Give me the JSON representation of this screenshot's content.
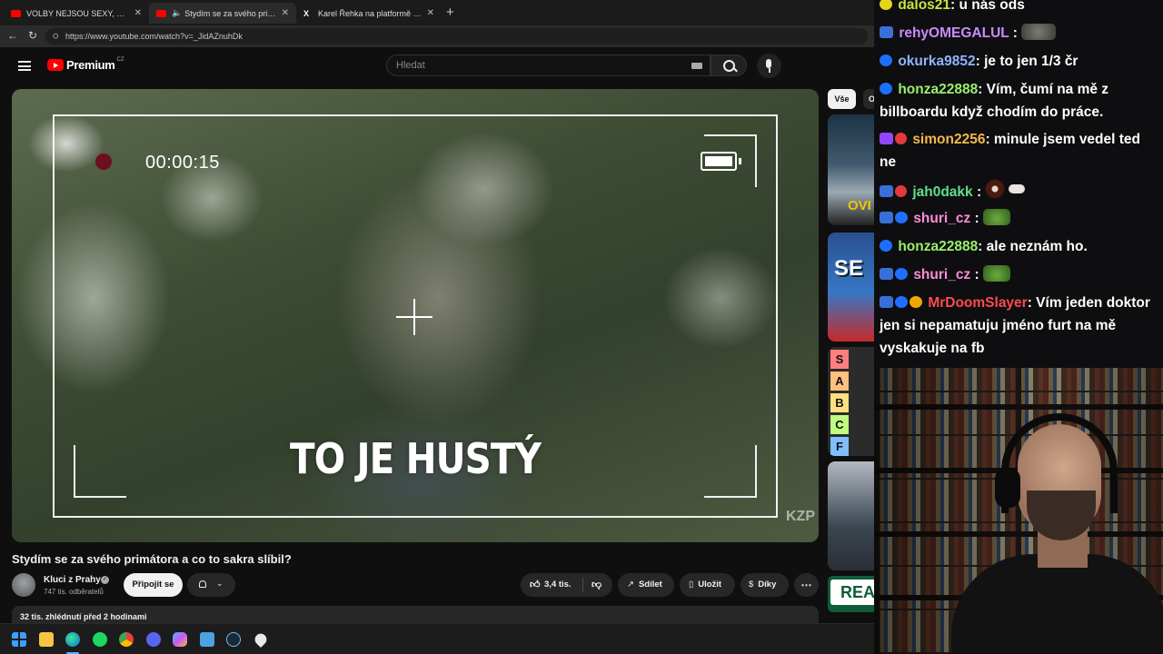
{
  "browser": {
    "tabs": [
      {
        "label": "VOLBY NEJSOU SEXY, Z NICH NEM",
        "icon": "youtube-icon",
        "active": false
      },
      {
        "label": "Stydím se za svého primátora",
        "icon": "youtube-icon",
        "active": true
      },
      {
        "label": "Karel Řehka na platformě X: „Po vi",
        "icon": "x-icon",
        "active": false
      }
    ],
    "url": "https://www.youtube.com/watch?v=_JidAZnuhDk"
  },
  "youtube": {
    "logo_text": "Premium",
    "logo_region": "CZ",
    "search_placeholder": "Hledat",
    "video": {
      "timecode": "00:00:15",
      "subtitle": "TO JE HUSTÝ",
      "watermark": "KZP"
    },
    "title": "Stydím se za svého primátora a co to sakra slíbil?",
    "channel": {
      "name": "Kluci z Prahy",
      "subscribers": "747 tis. odběratelů"
    },
    "join_label": "Připojit se",
    "likes": "3,4 tis.",
    "share_label": "Sdílet",
    "save_label": "Uložit",
    "thanks_label": "Díky",
    "description_meta": "32 tis. zhlédnutí  před 2 hodinami",
    "chips": [
      "Vše",
      "O"
    ],
    "recommendations": {
      "rec1_text": "OVI",
      "rec2_text": "SE",
      "rec3_tiers": [
        {
          "label": "S",
          "color": "#ff7f7f"
        },
        {
          "label": "A",
          "color": "#ffbf7f"
        },
        {
          "label": "B",
          "color": "#ffdf7f"
        },
        {
          "label": "C",
          "color": "#bfff7f"
        },
        {
          "label": "F",
          "color": "#7fbfff"
        }
      ],
      "rec5_text": "REA"
    }
  },
  "chat": {
    "messages": [
      {
        "user": "dalos21",
        "color": "#c8e63a",
        "text": ": u nás ods",
        "badges": [
          "yellow"
        ]
      },
      {
        "user": "rehyOMEGALUL",
        "color": "#c98cff",
        "text": " :",
        "badges": [
          "sub"
        ],
        "emote": "grey"
      },
      {
        "user": "okurka9852",
        "color": "#8fb4ff",
        "text": ": je to jen 1/3 čr",
        "badges": [
          "blue"
        ]
      },
      {
        "user": "honza22888",
        "color": "#9af06b",
        "text": ": Vím, čumí na mě z billboardu když chodím do práce.",
        "badges": [
          "blue"
        ]
      },
      {
        "user": "simon2256",
        "color": "#f2b84b",
        "text": ": minule jsem vedel ted ne",
        "badges": [
          "purple",
          "red"
        ]
      },
      {
        "user": "jah0dakk",
        "color": "#5fe08a",
        "text": " :",
        "badges": [
          "sub",
          "red"
        ],
        "emote": "brown"
      },
      {
        "user": "shuri_cz",
        "color": "#ff8cd8",
        "text": " :",
        "badges": [
          "sub",
          "blue"
        ],
        "emote": "frog"
      },
      {
        "user": "honza22888",
        "color": "#9af06b",
        "text": ": ale neznám ho.",
        "badges": [
          "blue"
        ]
      },
      {
        "user": "shuri_cz",
        "color": "#ff8cd8",
        "text": " :",
        "badges": [
          "sub",
          "blue"
        ],
        "emote": "frog"
      },
      {
        "user": "MrDoomSlayer",
        "color": "#ff4b4b",
        "text": ": Vím jeden doktor jen si nepamatuju jméno furt na mě vyskakuje na fb",
        "badges": [
          "sub",
          "blue",
          "gold"
        ]
      }
    ]
  }
}
